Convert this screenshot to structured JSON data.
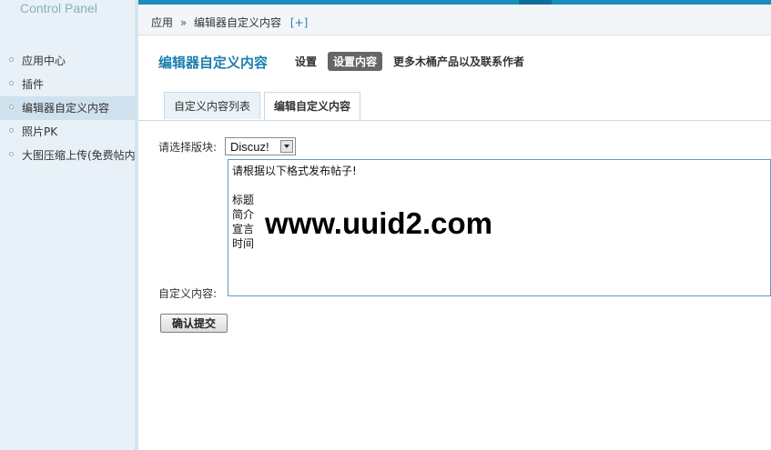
{
  "sidebar": {
    "logo": "Control Panel",
    "items": [
      {
        "label": "应用中心"
      },
      {
        "label": "插件"
      },
      {
        "label": "编辑器自定义内容"
      },
      {
        "label": "照片PK"
      },
      {
        "label": "大图压缩上传(免费帖内"
      }
    ]
  },
  "breadcrumb": {
    "root": "应用",
    "separator": "»",
    "current": "编辑器自定义内容",
    "add": "[+]"
  },
  "header": {
    "title": "编辑器自定义内容",
    "actions": [
      "设置",
      "设置内容",
      "更多木桶产品以及联系作者"
    ]
  },
  "tabs": [
    "自定义内容列表",
    "编辑自定义内容"
  ],
  "form": {
    "block_label": "请选择版块:",
    "block_selected": "Discuz!",
    "editor_lines": [
      "请根据以下格式发布帖子!",
      "",
      "标题",
      "简介",
      "宣言",
      "时间"
    ],
    "content_label": "自定义内容:",
    "submit_label": "确认提交"
  },
  "watermark": "www.uuid2.com",
  "colors": {
    "accent": "#1b8cbe",
    "title": "#1b7fae",
    "sidebar_bg": "#e8f1f7"
  }
}
